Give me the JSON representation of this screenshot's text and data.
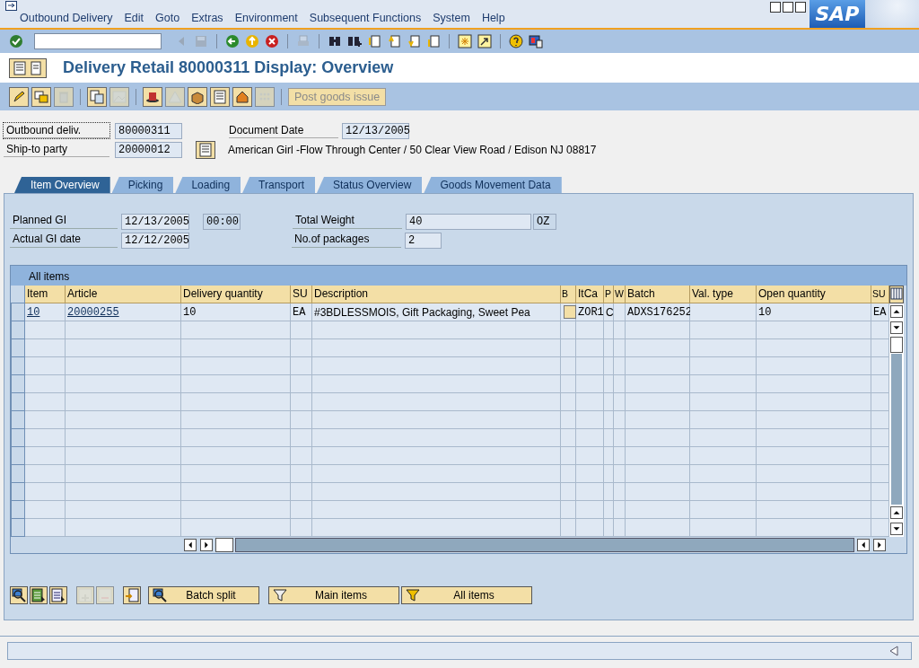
{
  "menu": [
    "Outbound Delivery",
    "Edit",
    "Goto",
    "Extras",
    "Environment",
    "Subsequent Functions",
    "System",
    "Help"
  ],
  "logo": "SAP",
  "system_toolbar": [
    {
      "disabled": false
    },
    {
      "disabled": true
    },
    {
      "disabled": true
    },
    {
      "disabled": false
    },
    {
      "disabled": false
    },
    {
      "disabled": false
    },
    {
      "disabled": true
    },
    {
      "disabled": false
    },
    {
      "disabled": false
    },
    {
      "disabled": false
    },
    {
      "disabled": false
    },
    {
      "disabled": false
    },
    {
      "disabled": false
    },
    {
      "disabled": false
    },
    {
      "disabled": false
    },
    {
      "disabled": false
    },
    {
      "disabled": false
    }
  ],
  "title": "Delivery Retail 80000311 Display: Overview",
  "app_toolbar": {
    "icons": [
      {
        "disabled": false
      },
      {
        "disabled": false
      },
      {
        "disabled": true
      },
      {
        "disabled": false
      },
      {
        "disabled": true
      },
      {
        "disabled": false
      },
      {
        "disabled": true
      },
      {
        "disabled": false
      },
      {
        "disabled": false
      },
      {
        "disabled": false
      },
      {
        "disabled": true
      }
    ],
    "button": {
      "label": "Post goods issue",
      "disabled": true
    }
  },
  "header": {
    "outbound_delivery": {
      "label": "Outbound deliv.",
      "value": "80000311"
    },
    "ship_to_party": {
      "label": "Ship-to party",
      "value": "20000012"
    },
    "document_date": {
      "label": "Document Date",
      "value": "12/13/2005"
    },
    "ship_to_address": "American Girl -Flow Through Center / 50 Clear View Road / Edison NJ 08817"
  },
  "tabs": [
    {
      "label": "Item Overview",
      "selected": true
    },
    {
      "label": "Picking",
      "selected": false
    },
    {
      "label": "Loading",
      "selected": false
    },
    {
      "label": "Transport",
      "selected": false
    },
    {
      "label": "Status Overview",
      "selected": false
    },
    {
      "label": "Goods Movement Data",
      "selected": false
    }
  ],
  "panel": {
    "planned_gi": {
      "label": "Planned GI",
      "date": "12/13/2005",
      "time": "00:00"
    },
    "actual_gi": {
      "label": "Actual GI date",
      "date": "12/12/2005"
    },
    "total_weight": {
      "label": "Total Weight",
      "value": "40",
      "unit": "OZ"
    },
    "packages": {
      "label": "No.of packages",
      "value": "2"
    }
  },
  "table": {
    "title": "All items",
    "columns": [
      "Item",
      "Article",
      "Delivery quantity",
      "SU",
      "Description",
      "B",
      "ItCa",
      "P",
      "W",
      "Batch",
      "Val. type",
      "Open quantity",
      "SU"
    ],
    "rows": [
      {
        "cells": [
          {
            "text": "10",
            "link": true
          },
          {
            "text": "20000255",
            "link": true
          },
          {
            "text": "10",
            "link": false
          },
          {
            "text": "EA",
            "link": false
          },
          {
            "text": "#3BDLESSMOIS, Gift Packaging, Sweet Pea",
            "link": false
          },
          null,
          {
            "text": "ZOR1",
            "link": false
          },
          {
            "text": "C",
            "link": false
          },
          null,
          {
            "text": "ADXS176252",
            "link": false
          },
          null,
          {
            "text": "10",
            "link": false
          },
          {
            "text": "EA",
            "link": false
          }
        ]
      }
    ]
  },
  "footer": {
    "icons": [
      {
        "disabled": false
      },
      {
        "disabled": false
      },
      {
        "disabled": false
      },
      {
        "disabled": true
      },
      {
        "disabled": true
      },
      {
        "disabled": false
      }
    ],
    "buttons": [
      {
        "label": "Batch split"
      },
      {
        "label": "Main items"
      },
      {
        "label": "All items"
      }
    ]
  }
}
